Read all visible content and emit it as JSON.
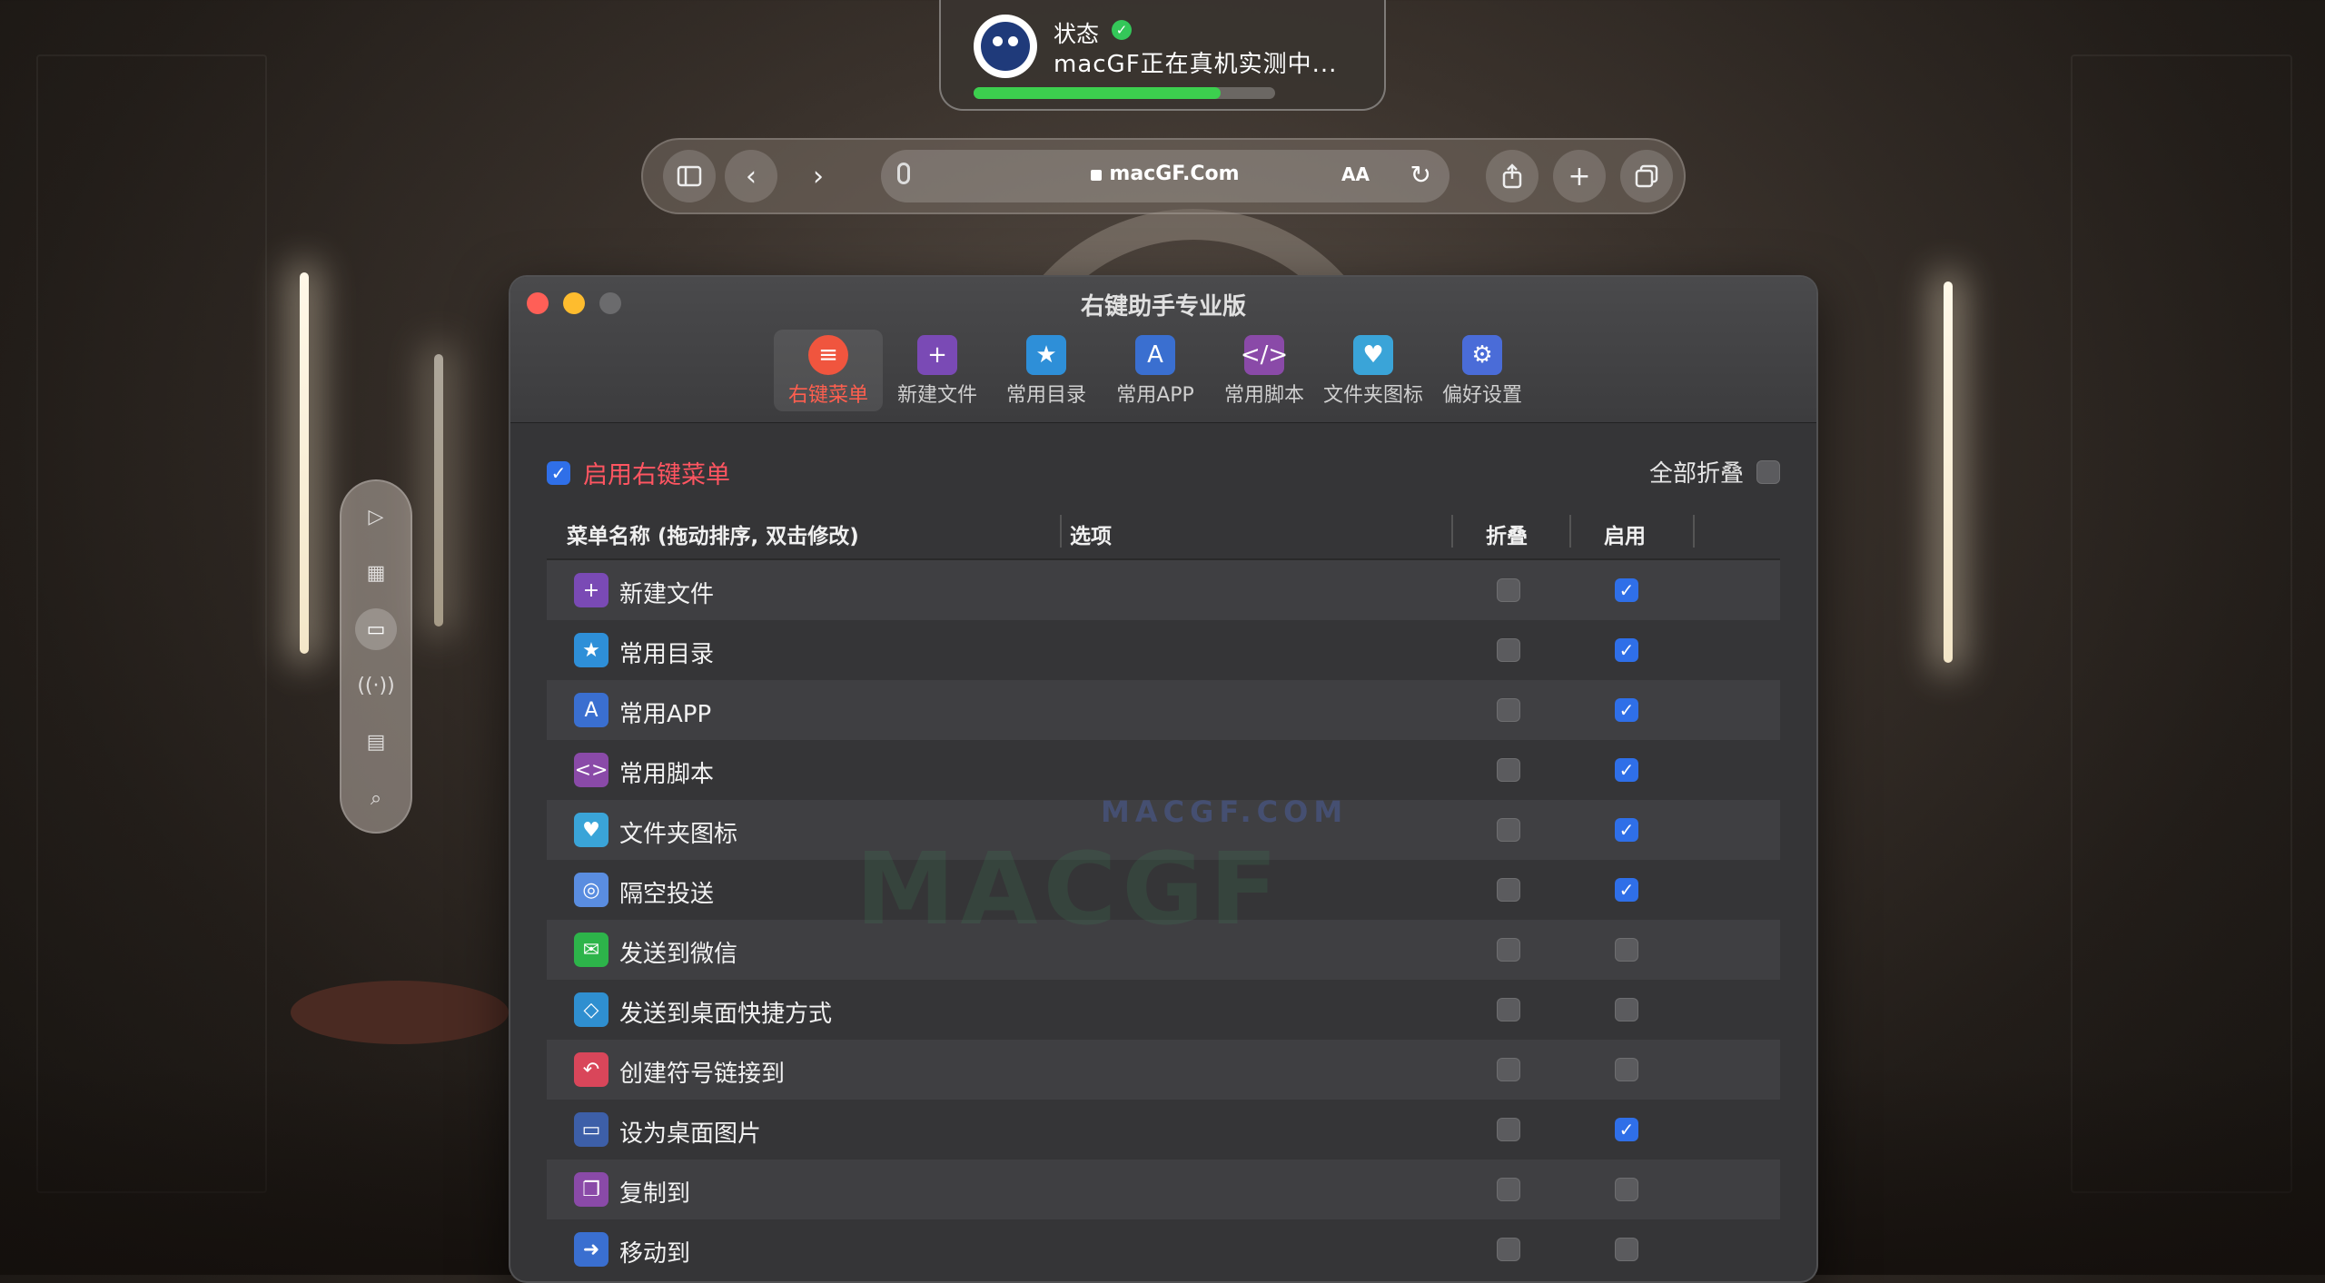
{
  "status": {
    "title": "状态",
    "message": "macGF正在真机实测中...",
    "progress": 0.82
  },
  "browser": {
    "url": "macGF.Com",
    "text_size_label": "AA",
    "icons": [
      "sidebar-icon",
      "back-icon",
      "forward-icon",
      "mic-icon",
      "lock-icon",
      "reload-icon",
      "share-icon",
      "plus-icon",
      "tabs-icon"
    ]
  },
  "dock": {
    "icons": [
      "play-icon",
      "grid-icon",
      "screen-share-icon",
      "broadcast-icon",
      "clipboard-icon",
      "search-icon"
    ]
  },
  "window": {
    "title": "右键助手专业版",
    "tabs": [
      {
        "label": "右键菜单",
        "icon": "≡",
        "color": "#f0553e",
        "selected": true
      },
      {
        "label": "新建文件",
        "icon": "+",
        "color": "#7a4ab5"
      },
      {
        "label": "常用目录",
        "icon": "★",
        "color": "#2e8fd8"
      },
      {
        "label": "常用APP",
        "icon": "A",
        "color": "#3a6fd0"
      },
      {
        "label": "常用脚本",
        "icon": "</>",
        "color": "#8a4aa8"
      },
      {
        "label": "文件夹图标",
        "icon": "♥",
        "color": "#3aa4d8"
      },
      {
        "label": "偏好设置",
        "icon": "⚙",
        "color": "#4a6cd8"
      }
    ],
    "enable_label": "启用右键菜单",
    "collapse_all_label": "全部折叠",
    "columns": {
      "name": "菜单名称 (拖动排序, 双击修改)",
      "options": "选项",
      "fold": "折叠",
      "enable": "启用"
    },
    "rows": [
      {
        "name": "新建文件",
        "icon": "+",
        "color": "#7a4ab5",
        "fold": false,
        "enabled": true
      },
      {
        "name": "常用目录",
        "icon": "★",
        "color": "#2e8fd8",
        "fold": false,
        "enabled": true
      },
      {
        "name": "常用APP",
        "icon": "A",
        "color": "#3a6fd0",
        "fold": false,
        "enabled": true
      },
      {
        "name": "常用脚本",
        "icon": "<>",
        "color": "#8a4aa8",
        "fold": false,
        "enabled": true
      },
      {
        "name": "文件夹图标",
        "icon": "♥",
        "color": "#3aa4d8",
        "fold": false,
        "enabled": true
      },
      {
        "name": "隔空投送",
        "icon": "◎",
        "color": "#5a8de0",
        "fold": false,
        "enabled": true
      },
      {
        "name": "发送到微信",
        "icon": "✉",
        "color": "#2db44a",
        "fold": false,
        "enabled": false
      },
      {
        "name": "发送到桌面快捷方式",
        "icon": "◇",
        "color": "#2f8fd0",
        "fold": false,
        "enabled": false
      },
      {
        "name": "创建符号链接到",
        "icon": "↶",
        "color": "#d9465a",
        "fold": false,
        "enabled": false
      },
      {
        "name": "设为桌面图片",
        "icon": "▭",
        "color": "#3d5fa8",
        "fold": false,
        "enabled": true
      },
      {
        "name": "复制到",
        "icon": "❐",
        "color": "#8a4aa8",
        "fold": false,
        "enabled": false
      },
      {
        "name": "移动到",
        "icon": "➜",
        "color": "#3a6fd0",
        "fold": false,
        "enabled": false
      }
    ]
  },
  "watermarks": [
    "MACGF.COM",
    "MACGF"
  ]
}
